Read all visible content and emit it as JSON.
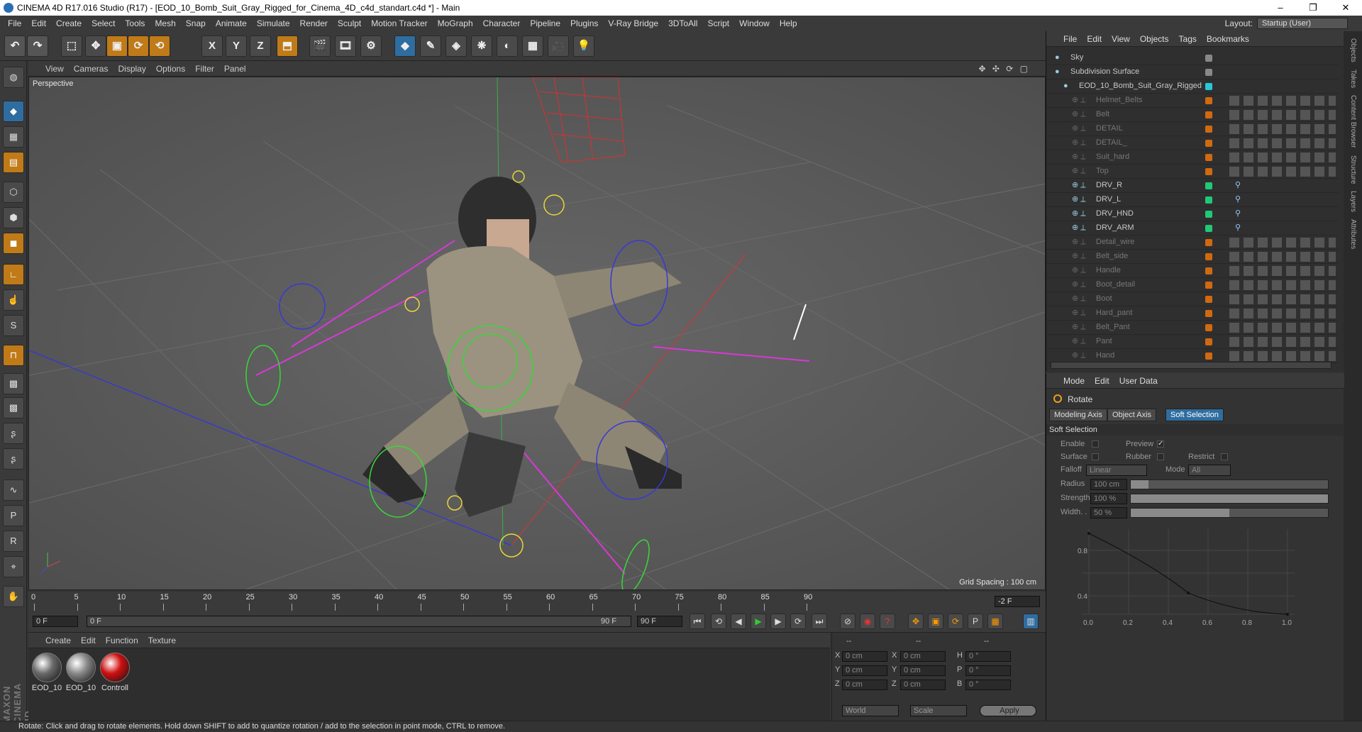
{
  "window": {
    "title": "CINEMA 4D R17.016 Studio (R17) - [EOD_10_Bomb_Suit_Gray_Rigged_for_Cinema_4D_c4d_standart.c4d *] - Main",
    "controls": [
      "–",
      "❐",
      "✕"
    ]
  },
  "menu": [
    "File",
    "Edit",
    "Create",
    "Select",
    "Tools",
    "Mesh",
    "Snap",
    "Animate",
    "Simulate",
    "Render",
    "Sculpt",
    "Motion Tracker",
    "MoGraph",
    "Character",
    "Pipeline",
    "Plugins",
    "V-Ray Bridge",
    "3DToAll",
    "Script",
    "Window",
    "Help"
  ],
  "layout": {
    "label": "Layout:",
    "value": "Startup (User)"
  },
  "toolbar": {
    "axis_x": "X",
    "axis_y": "Y",
    "axis_z": "Z"
  },
  "viewport": {
    "menu": [
      "View",
      "Cameras",
      "Display",
      "Options",
      "Filter",
      "Panel"
    ],
    "label": "Perspective",
    "grid_spacing": "Grid Spacing : 100 cm",
    "nav_icons": "✥ ✣ ⟳ ▢"
  },
  "timeline": {
    "ticks": [
      "0",
      "5",
      "10",
      "15",
      "20",
      "25",
      "30",
      "35",
      "40",
      "45",
      "50",
      "55",
      "60",
      "65",
      "70",
      "75",
      "80",
      "85",
      "90"
    ],
    "current_frame": "-2 F",
    "start": "0 F",
    "slider_start": "0 F",
    "slider_end": "90 F",
    "end": "90 F"
  },
  "materials": {
    "menu": [
      "Create",
      "Edit",
      "Function",
      "Texture"
    ],
    "items": [
      {
        "name": "EOD_10",
        "color": "#6a6a6a"
      },
      {
        "name": "EOD_10",
        "color": "#8a8a8a"
      },
      {
        "name": "Controll",
        "color": "#d01010"
      }
    ]
  },
  "coords": {
    "header": [
      "--",
      "--",
      "--"
    ],
    "rows": [
      {
        "a": "X",
        "av": "0 cm",
        "b": "X",
        "bv": "0 cm",
        "c": "H",
        "cv": "0 °"
      },
      {
        "a": "Y",
        "av": "0 cm",
        "b": "Y",
        "bv": "0 cm",
        "c": "P",
        "cv": "0 °"
      },
      {
        "a": "Z",
        "av": "0 cm",
        "b": "Z",
        "bv": "0 cm",
        "c": "B",
        "cv": "0 °"
      }
    ],
    "space": "World",
    "mode": "Scale",
    "apply": "Apply"
  },
  "objects": {
    "menu": [
      "File",
      "Edit",
      "View",
      "Objects",
      "Tags",
      "Bookmarks"
    ],
    "rows": [
      {
        "name": "Sky",
        "indent": 0,
        "dim": false,
        "color": "#888"
      },
      {
        "name": "Subdivision Surface",
        "indent": 0,
        "dim": false,
        "color": "#888"
      },
      {
        "name": "EOD_10_Bomb_Suit_Gray_Rigged",
        "indent": 1,
        "dim": false,
        "color": "#28c8d8"
      },
      {
        "name": "Helmet_Belts",
        "indent": 2,
        "dim": true,
        "color": "#d06a10"
      },
      {
        "name": "Belt",
        "indent": 2,
        "dim": true,
        "color": "#d06a10"
      },
      {
        "name": "DETAIL",
        "indent": 2,
        "dim": true,
        "color": "#d06a10"
      },
      {
        "name": "DETAIL_",
        "indent": 2,
        "dim": true,
        "color": "#d06a10"
      },
      {
        "name": "Suit_hard",
        "indent": 2,
        "dim": true,
        "color": "#d06a10"
      },
      {
        "name": "Top",
        "indent": 2,
        "dim": true,
        "color": "#d06a10"
      },
      {
        "name": "DRV_R",
        "indent": 2,
        "dim": false,
        "color": "#20c878"
      },
      {
        "name": "DRV_L",
        "indent": 2,
        "dim": false,
        "color": "#20c878"
      },
      {
        "name": "DRV_HND",
        "indent": 2,
        "dim": false,
        "color": "#20c878"
      },
      {
        "name": "DRV_ARM",
        "indent": 2,
        "dim": false,
        "color": "#20c878"
      },
      {
        "name": "Detail_wire",
        "indent": 2,
        "dim": true,
        "color": "#d06a10"
      },
      {
        "name": "Belt_side",
        "indent": 2,
        "dim": true,
        "color": "#d06a10"
      },
      {
        "name": "Handle",
        "indent": 2,
        "dim": true,
        "color": "#d06a10"
      },
      {
        "name": "Boot_detail",
        "indent": 2,
        "dim": true,
        "color": "#d06a10"
      },
      {
        "name": "Boot",
        "indent": 2,
        "dim": true,
        "color": "#d06a10"
      },
      {
        "name": "Hard_pant",
        "indent": 2,
        "dim": true,
        "color": "#d06a10"
      },
      {
        "name": "Belt_Pant",
        "indent": 2,
        "dim": true,
        "color": "#d06a10"
      },
      {
        "name": "Pant",
        "indent": 2,
        "dim": true,
        "color": "#d06a10"
      },
      {
        "name": "Hand",
        "indent": 2,
        "dim": true,
        "color": "#d06a10"
      }
    ]
  },
  "side_tabs": [
    "Objects",
    "Takes",
    "Content Browser",
    "Structure",
    "Layers",
    "Attributes"
  ],
  "attributes": {
    "menu": [
      "Mode",
      "Edit",
      "User Data"
    ],
    "tool": "Rotate",
    "tabs": [
      "Modeling Axis",
      "Object Axis",
      "Soft Selection"
    ],
    "active_tab": "Soft Selection",
    "section": "Soft Selection",
    "enable": "Enable",
    "preview": "Preview",
    "preview_check": "✓",
    "surface": "Surface",
    "rubber": "Rubber",
    "restrict": "Restrict",
    "falloff_label": "Falloff",
    "falloff": "Linear",
    "mode_label": "Mode",
    "mode": "All",
    "radius_label": "Radius",
    "radius": "100 cm",
    "radius_level": 0.09,
    "strength_label": "Strength",
    "strength": "100 %",
    "strength_level": 1.0,
    "width_label": "Width. .",
    "width": "50 %",
    "width_level": 0.5,
    "graph_x": [
      "0.0",
      "0.2",
      "0.4",
      "0.6",
      "0.8",
      "1.0"
    ],
    "graph_y": [
      "0.8",
      "0.4"
    ]
  },
  "status": "Rotate: Click and drag to rotate elements. Hold down SHIFT to add to quantize rotation / add to the selection in point mode, CTRL to remove."
}
